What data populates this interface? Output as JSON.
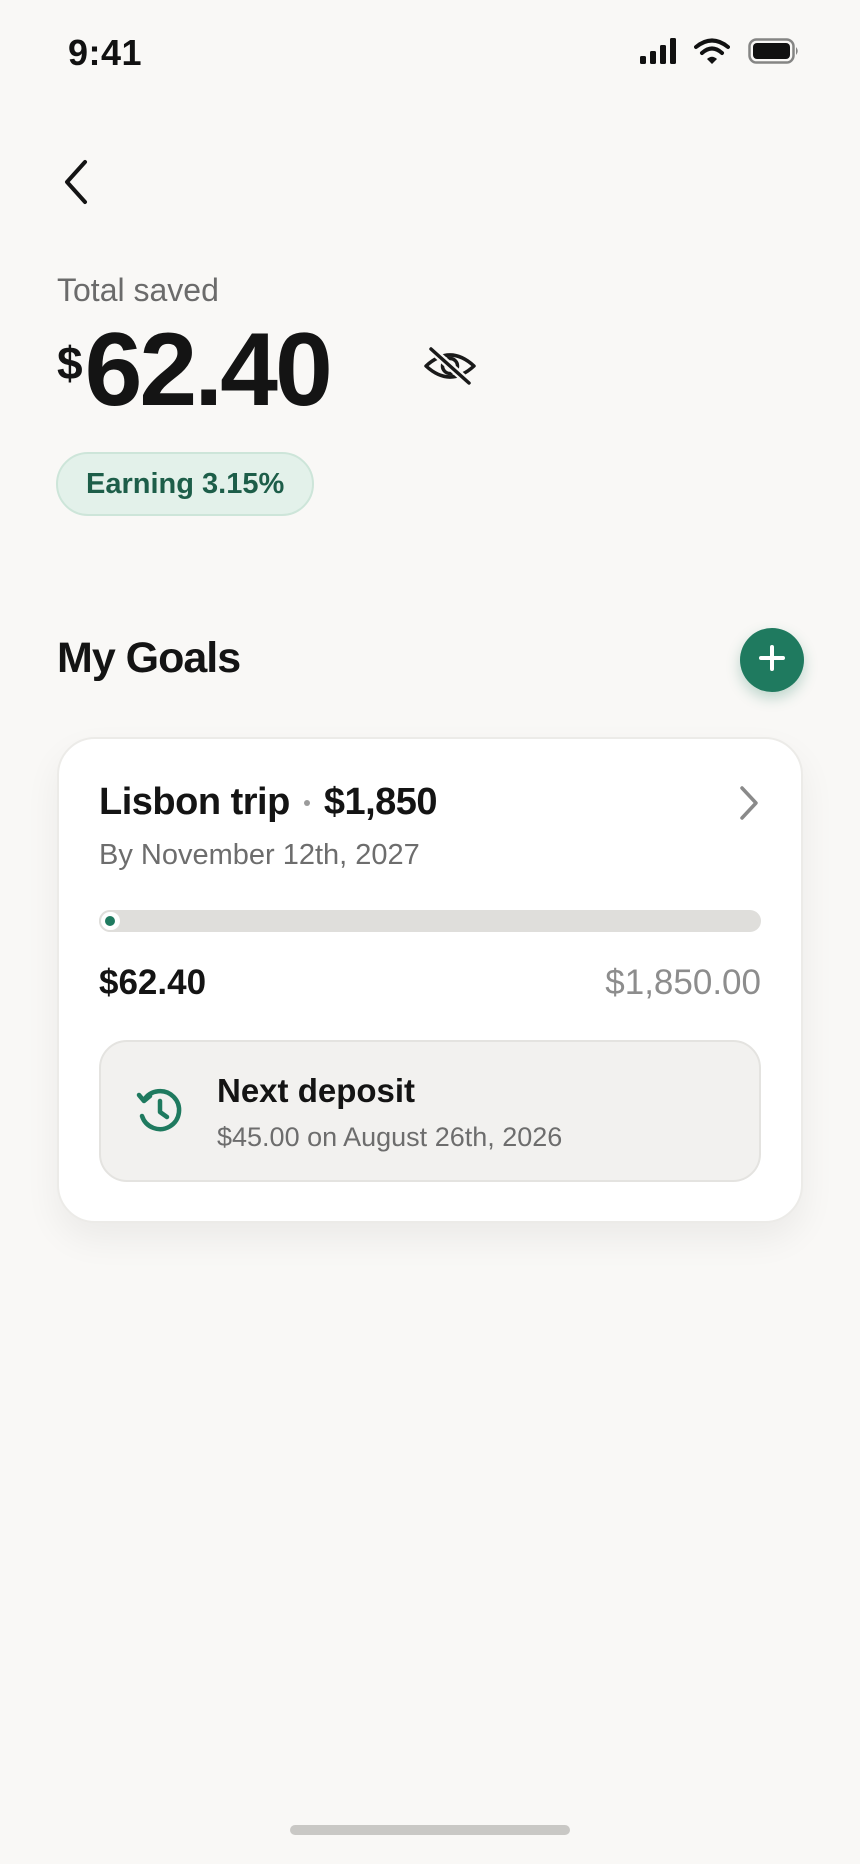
{
  "status_bar": {
    "time": "9:41"
  },
  "summary": {
    "label": "Total saved",
    "currency_symbol": "$",
    "amount": "62.40",
    "earning_badge": "Earning 3.15%"
  },
  "goals": {
    "title": "My Goals",
    "items": [
      {
        "name": "Lisbon trip",
        "target_short": "$1,850",
        "due": "By November 12th, 2027",
        "saved": "$62.40",
        "target": "$1,850.00",
        "progress_fraction": 0.034,
        "next_deposit": {
          "title": "Next deposit",
          "detail": "$45.00 on August 26th, 2026"
        }
      }
    ]
  },
  "colors": {
    "accent": "#1f7a5f",
    "background": "#f9f8f6",
    "badge_bg": "#e3f1ea",
    "badge_text": "#1d5e49"
  },
  "icons": {
    "back": "chevron-left-icon",
    "hide_balance": "eye-slash-icon",
    "add_goal": "plus-icon",
    "goal_open": "chevron-right-icon",
    "deposit": "history-clock-icon",
    "signal": "cellular-signal-icon",
    "wifi": "wifi-icon",
    "battery": "battery-icon"
  }
}
